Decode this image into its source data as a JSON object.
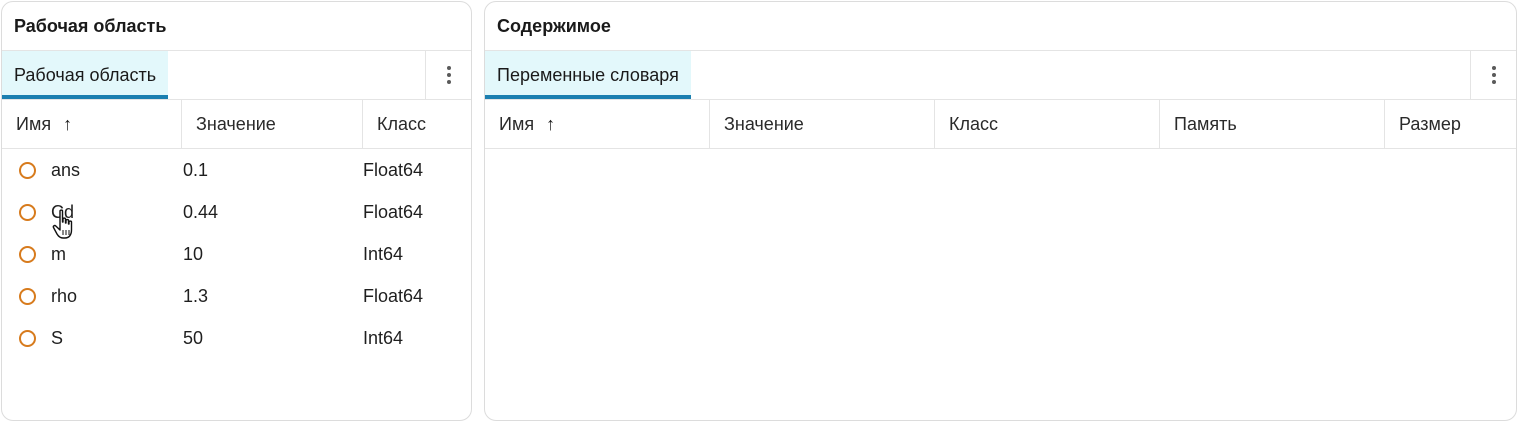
{
  "left_panel": {
    "title": "Рабочая область",
    "tab_label": "Рабочая область",
    "columns": {
      "name": "Имя",
      "value": "Значение",
      "class": "Класс"
    },
    "sort_icon": "arrow-up-icon",
    "rows": [
      {
        "name": "ans",
        "value": "0.1",
        "class": "Float64"
      },
      {
        "name": "Cd",
        "value": "0.44",
        "class": "Float64"
      },
      {
        "name": "m",
        "value": "10",
        "class": "Int64"
      },
      {
        "name": "rho",
        "value": "1.3",
        "class": "Float64"
      },
      {
        "name": "S",
        "value": "50",
        "class": "Int64"
      }
    ]
  },
  "right_panel": {
    "title": "Содержимое",
    "tab_label": "Переменные словаря",
    "columns": {
      "name": "Имя",
      "value": "Значение",
      "class": "Класс",
      "memory": "Память",
      "size": "Размер"
    }
  },
  "colors": {
    "accent": "#1b7fb0",
    "tab_bg": "#e3f8fb",
    "variable_circle": "#d77b1d"
  }
}
